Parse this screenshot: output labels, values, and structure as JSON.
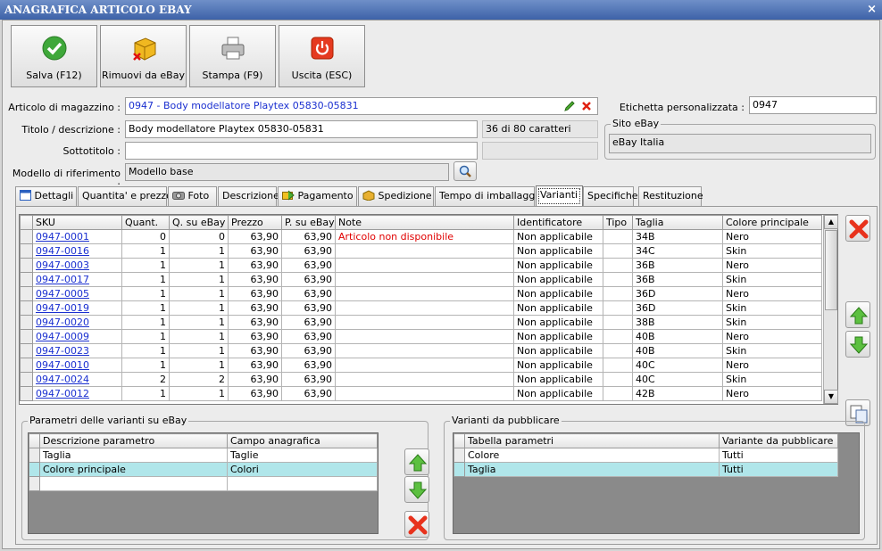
{
  "window": {
    "title": "ANAGRAFICA ARTICOLO EBAY",
    "close": "×"
  },
  "toolbar": {
    "save": "Salva (F12)",
    "remove": "Rimuovi da eBay",
    "print": "Stampa (F9)",
    "exit": "Uscita (ESC)"
  },
  "form": {
    "articolo_label": "Articolo di magazzino :",
    "articolo_value": "0947 - Body modellatore Playtex 05830-05831",
    "titolo_label": "Titolo / descrizione :",
    "titolo_value": "Body modellatore Playtex 05830-05831",
    "char_count": "36 di 80 caratteri",
    "sottotitolo_label": "Sottotitolo :",
    "sottotitolo_value": "",
    "modello_label": "Modello di riferimento :",
    "modello_value": "Modello base",
    "etichetta_label": "Etichetta personalizzata :",
    "etichetta_value": "0947",
    "sito_group": "Sito eBay",
    "sito_value": "eBay Italia"
  },
  "tabs": [
    "Dettagli",
    "Quantita' e prezzo",
    "Foto",
    "Descrizione",
    "Pagamento",
    "Spedizione",
    "Tempo di imballaggio",
    "Varianti",
    "Specifiche",
    "Restituzione"
  ],
  "active_tab": "Varianti",
  "variants": {
    "headers": [
      "SKU",
      "Quant.",
      "Q. su eBay",
      "Prezzo",
      "P. su eBay",
      "Note",
      "Identificatore",
      "Tipo",
      "Taglia",
      "Colore principale"
    ],
    "rows": [
      [
        "0947-0001",
        "0",
        "0",
        "63,90",
        "63,90",
        "Articolo non disponibile",
        "Non applicabile",
        "",
        "34B",
        "Nero"
      ],
      [
        "0947-0016",
        "1",
        "1",
        "63,90",
        "63,90",
        "",
        "Non applicabile",
        "",
        "34C",
        "Skin"
      ],
      [
        "0947-0003",
        "1",
        "1",
        "63,90",
        "63,90",
        "",
        "Non applicabile",
        "",
        "36B",
        "Nero"
      ],
      [
        "0947-0017",
        "1",
        "1",
        "63,90",
        "63,90",
        "",
        "Non applicabile",
        "",
        "36B",
        "Skin"
      ],
      [
        "0947-0005",
        "1",
        "1",
        "63,90",
        "63,90",
        "",
        "Non applicabile",
        "",
        "36D",
        "Nero"
      ],
      [
        "0947-0019",
        "1",
        "1",
        "63,90",
        "63,90",
        "",
        "Non applicabile",
        "",
        "36D",
        "Skin"
      ],
      [
        "0947-0020",
        "1",
        "1",
        "63,90",
        "63,90",
        "",
        "Non applicabile",
        "",
        "38B",
        "Skin"
      ],
      [
        "0947-0009",
        "1",
        "1",
        "63,90",
        "63,90",
        "",
        "Non applicabile",
        "",
        "40B",
        "Nero"
      ],
      [
        "0947-0023",
        "1",
        "1",
        "63,90",
        "63,90",
        "",
        "Non applicabile",
        "",
        "40B",
        "Skin"
      ],
      [
        "0947-0010",
        "1",
        "1",
        "63,90",
        "63,90",
        "",
        "Non applicabile",
        "",
        "40C",
        "Nero"
      ],
      [
        "0947-0024",
        "2",
        "2",
        "63,90",
        "63,90",
        "",
        "Non applicabile",
        "",
        "40C",
        "Skin"
      ],
      [
        "0947-0012",
        "1",
        "1",
        "63,90",
        "63,90",
        "",
        "Non applicabile",
        "",
        "42B",
        "Nero"
      ]
    ]
  },
  "params": {
    "group": "Parametri delle varianti su eBay",
    "headers": [
      "Descrizione parametro",
      "Campo anagrafica"
    ],
    "rows": [
      [
        "Taglia",
        "Taglie"
      ],
      [
        "Colore principale",
        "Colori"
      ]
    ]
  },
  "publish": {
    "group": "Varianti da pubblicare",
    "headers": [
      "Tabella parametri",
      "Variante da pubblicare"
    ],
    "rows": [
      [
        "Colore",
        "Tutti"
      ],
      [
        "Taglia",
        "Tutti"
      ]
    ]
  },
  "colors": {
    "title_bar": "#3d62a8",
    "selected_row": "#b0e6ea",
    "link": "#1a2fd0",
    "warning_text": "#e00000"
  }
}
